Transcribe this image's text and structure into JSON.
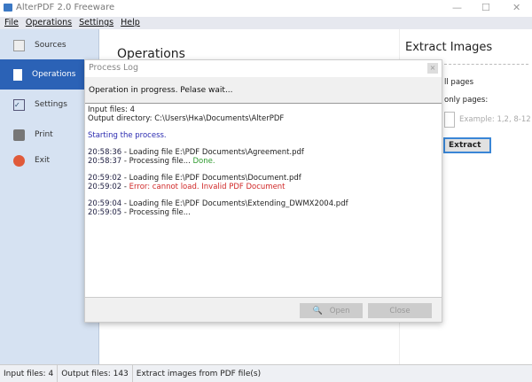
{
  "window": {
    "title": "AlterPDF 2.0 Freeware"
  },
  "menu": [
    "File",
    "Operations",
    "Settings",
    "Help"
  ],
  "sidebar": {
    "items": [
      {
        "label": "Sources",
        "icon": "sources-icon"
      },
      {
        "label": "Operations",
        "icon": "operations-icon",
        "active": true
      },
      {
        "label": "Settings",
        "icon": "settings-icon"
      },
      {
        "label": "Print",
        "icon": "print-icon"
      },
      {
        "label": "Exit",
        "icon": "exit-icon"
      }
    ]
  },
  "main": {
    "heading": "Operations"
  },
  "right": {
    "heading": "Extract Images",
    "all_pages": "ll pages",
    "only_pages": "only pages:",
    "pages_placeholder": "Example: 1,2, 8-12",
    "extract_label": "Extract"
  },
  "dialog": {
    "title": "Process Log",
    "close_glyph": "×",
    "status": "Operation in progress. Pelase wait...",
    "log": {
      "l1": "Input files: 4",
      "l2": "Output directory: C:\\Users\\Hка\\Documents\\AlterPDF",
      "l3": "Starting the process.",
      "t1": "20:58:36",
      "m1": " - Loading file E:\\PDF Documents\\Agreement.pdf",
      "t2": "20:58:37",
      "m2": " - Processing file... ",
      "s2": "Done.",
      "t3": "20:59:02",
      "m3": " - Loading file E:\\PDF Documents\\Document.pdf",
      "t4": "20:59:02",
      "m4": " - ",
      "s4": "Error: cannot load. Invalid PDF Document",
      "t5": "20:59:04",
      "m5": " - Loading file E:\\PDF Documents\\Extending_DWMX2004.pdf",
      "t6": "20:59:05",
      "m6": " - Processing file..."
    },
    "open_label": "Open",
    "close_label": "Close"
  },
  "statusbar": {
    "input": "Input files: 4",
    "output": "Output files: 143",
    "desc": "Extract images from PDF file(s)"
  },
  "colors": {
    "accent": "#2b62b6",
    "sidebar": "#d6e2f2"
  }
}
